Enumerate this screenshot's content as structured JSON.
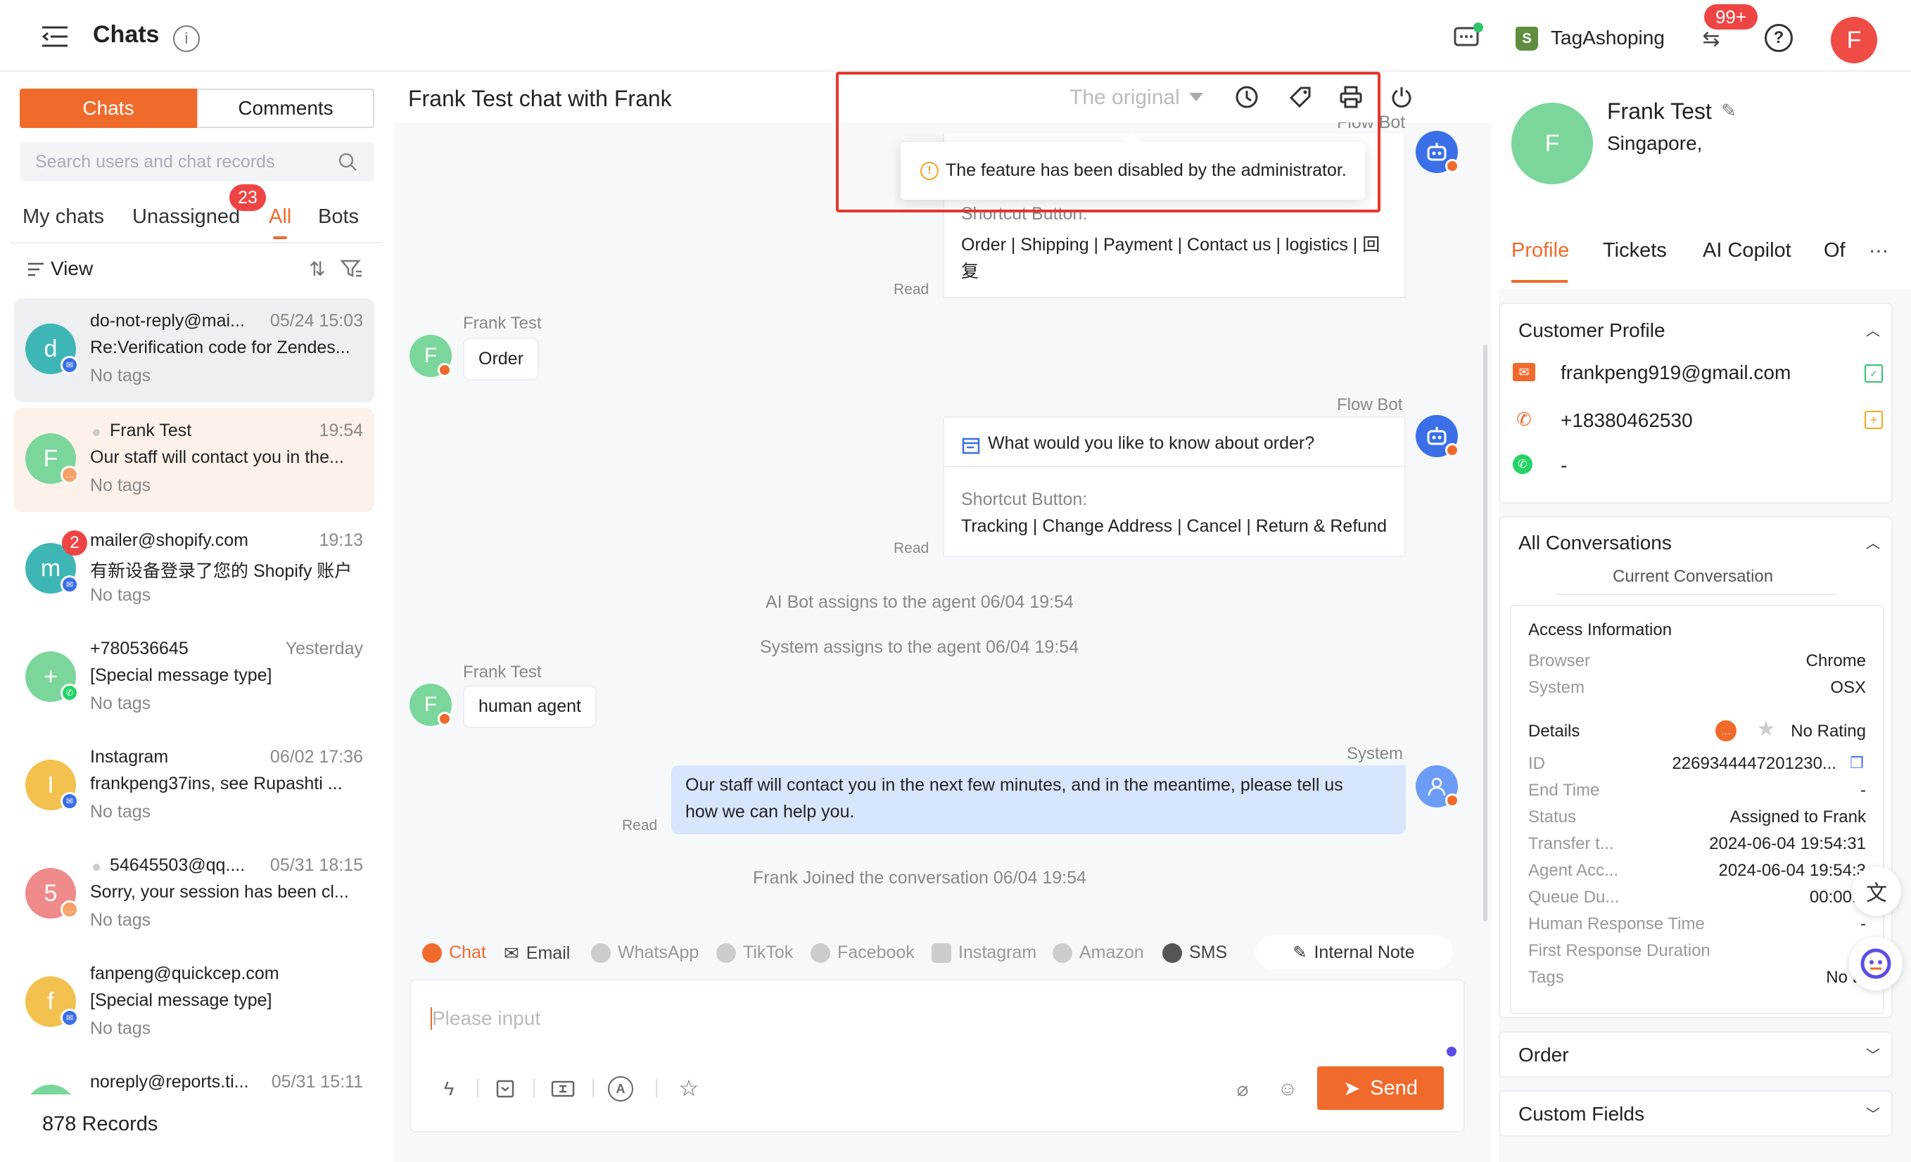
{
  "header": {
    "title": "Chats",
    "store_name": "TagAshoping",
    "notification_count": "99+",
    "user_initial": "F"
  },
  "left": {
    "segments": [
      "Chats",
      "Comments"
    ],
    "search_placeholder": "Search users and chat records",
    "tabs": [
      "My chats",
      "Unassigned",
      "All",
      "Bots"
    ],
    "unassigned_count": "23",
    "view_label": "View",
    "records": "878 Records",
    "conversations": [
      {
        "initial": "d",
        "name": "do-not-reply@mai...",
        "time": "05/24 15:03",
        "preview": "Re:Verification code for Zendes...",
        "tags": "No tags",
        "color": "#3fb6b6"
      },
      {
        "initial": "F",
        "name": "Frank Test",
        "time": "19:54",
        "preview": "Our staff will contact you in the...",
        "tags": "No tags",
        "color": "#7bd69b"
      },
      {
        "initial": "m",
        "name": "mailer@shopify.com",
        "time": "19:13",
        "preview": "有新设备登录了您的 Shopify 账户",
        "tags": "No tags",
        "color": "#3fb6b6",
        "unread": "2"
      },
      {
        "initial": "+",
        "name": "+780536645",
        "time": "Yesterday",
        "preview": "[Special message type]",
        "tags": "No tags",
        "color": "#7bd69b"
      },
      {
        "initial": "I",
        "name": "Instagram",
        "time": "06/02 17:36",
        "preview": "frankpeng37ins, see Rupashti ...",
        "tags": "No tags",
        "color": "#f2c14e"
      },
      {
        "initial": "5",
        "name": "54645503@qq....",
        "time": "05/31 18:15",
        "preview": "Sorry, your session has been cl...",
        "tags": "No tags",
        "color": "#ef8a8a"
      },
      {
        "initial": "f",
        "name": "fanpeng@quickcep.com",
        "time": "",
        "preview": "[Special message type]",
        "tags": "No tags",
        "color": "#f2c14e"
      },
      {
        "initial": "n",
        "name": "noreply@reports.ti...",
        "time": "05/31 15:11",
        "preview": "",
        "tags": "",
        "color": "#7bd69b"
      }
    ]
  },
  "chat": {
    "title": "Frank Test chat with Frank",
    "translation": "The original",
    "disabled_notice": "The feature has been disabled by the administrator.",
    "top_card": {
      "partial_name": "Flow Bot",
      "shortcut_label": "Shortcut Button:",
      "shortcuts": "Order | Shipping | Payment | Contact us | logistics | 回",
      "shortcuts_cont": "复",
      "read": "Read"
    },
    "user_msg1": {
      "name": "Frank Test",
      "text": "Order"
    },
    "bot_msg": {
      "name": "Flow Bot",
      "question": "What would you like to know about order?",
      "shortcut_label": "Shortcut Button:",
      "shortcuts": "Tracking | Change Address | Cancel | Return & Refund",
      "read": "Read"
    },
    "sys1": "AI Bot assigns to the agent  06/04 19:54",
    "sys2": "System assigns to the agent  06/04 19:54",
    "user_msg2": {
      "name": "Frank Test",
      "text": "human agent"
    },
    "system_msg": {
      "name": "System",
      "line1": "Our staff will contact you in the next few minutes, and in the meantime, please tell us",
      "line2": "how we can help you.",
      "read": "Read"
    },
    "sys3": "Frank Joined the conversation  06/04 19:54",
    "channels": [
      "Chat",
      "Email",
      "WhatsApp",
      "TikTok",
      "Facebook",
      "Instagram",
      "Amazon",
      "SMS"
    ],
    "internal_note": "Internal Note",
    "input_placeholder": "Please input",
    "send": "Send"
  },
  "profile": {
    "initial": "F",
    "name": "Frank Test",
    "location": "Singapore,",
    "tabs": [
      "Profile",
      "Tickets",
      "AI Copilot",
      "Of"
    ],
    "customer_profile": "Customer Profile",
    "email": "frankpeng919@gmail.com",
    "phone": "+18380462530",
    "whatsapp": "-",
    "all_conversations": "All Conversations",
    "current_conversation": "Current Conversation",
    "access_info": "Access Information",
    "browser_k": "Browser",
    "browser_v": "Chrome",
    "system_k": "System",
    "system_v": "OSX",
    "details": "Details",
    "rating": "No Rating",
    "rows": [
      {
        "k": "ID",
        "v": "2269344447201230..."
      },
      {
        "k": "End Time",
        "v": "-"
      },
      {
        "k": "Status",
        "v": "Assigned to Frank"
      },
      {
        "k": "Transfer t...",
        "v": "2024-06-04 19:54:31"
      },
      {
        "k": "Agent Acc...",
        "v": "2024-06-04 19:54:3"
      },
      {
        "k": "Queue Du...",
        "v": "00:00:0"
      },
      {
        "k": "Human Response Time",
        "v": "-"
      },
      {
        "k": "First Response Duration",
        "v": ""
      },
      {
        "k": "Tags",
        "v": "No tag"
      }
    ],
    "order": "Order",
    "custom_fields": "Custom Fields"
  }
}
